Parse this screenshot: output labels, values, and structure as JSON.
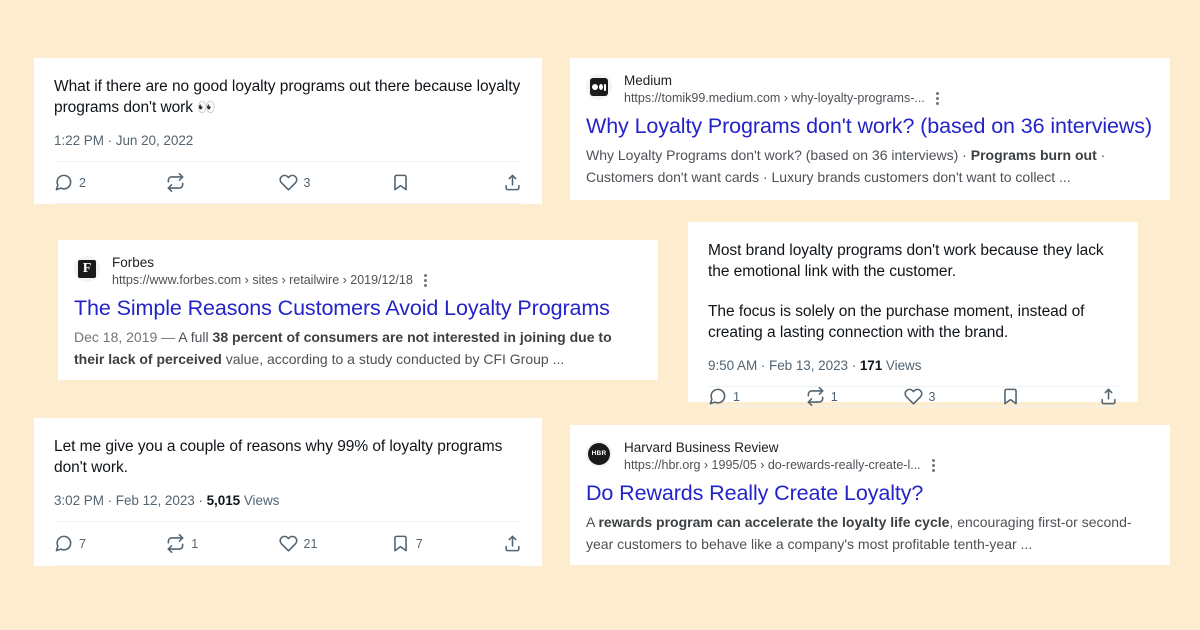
{
  "page": {
    "background_color": "#fdecce",
    "card_background": "#ffffff"
  },
  "colors": {
    "link_blue": "#1a0dab",
    "link_blue_alt": "#2323c8",
    "tweet_text": "#0f1419",
    "tweet_meta": "#536471",
    "snippet": "#4d5156"
  },
  "cards": {
    "tweet1": {
      "name": "tweet-card-no-good-loyalty-programs",
      "text_lines": [
        "What if there are no good loyalty programs out there because loyalty programs don't work"
      ],
      "emoji": "👀",
      "timestamp": "1:22 PM · Jun 20, 2022",
      "views": "",
      "views_label": "",
      "actions": {
        "reply": "2",
        "retweet": "",
        "like": "3",
        "bookmark": "",
        "share": ""
      }
    },
    "tweet2": {
      "name": "tweet-card-emotional-link",
      "text_lines": [
        "Most brand loyalty programs don't work because they lack the emotional link with the customer.",
        "The focus is solely on the purchase moment, instead of creating a lasting connection with the brand."
      ],
      "emoji": "",
      "timestamp": "9:50 AM · Feb 13, 2023 · ",
      "views": "171",
      "views_label": " Views",
      "actions": {
        "reply": "1",
        "retweet": "1",
        "like": "3",
        "bookmark": "",
        "share": ""
      }
    },
    "tweet3": {
      "name": "tweet-card-99-percent",
      "text_lines": [
        "Let me give you a couple of reasons why 99% of loyalty programs don't work."
      ],
      "emoji": "",
      "timestamp": "3:02 PM · Feb 12, 2023 · ",
      "views": "5,015",
      "views_label": " Views",
      "actions": {
        "reply": "7",
        "retweet": "1",
        "like": "21",
        "bookmark": "7",
        "share": ""
      }
    },
    "result_medium": {
      "name": "search-result-medium",
      "favicon_icon": "medium-favicon-icon",
      "site": "Medium",
      "url": "https://tomik99.medium.com › why-loyalty-programs-...",
      "title": "Why Loyalty Programs don't work? (based on 36 interviews)",
      "snippet_parts": [
        {
          "text": "Why Loyalty Programs don't work? (based on 36 interviews) · ",
          "bold": false
        },
        {
          "text": "Programs burn out",
          "bold": true
        },
        {
          "text": " · Customers don't want cards · Luxury brands customers don't want to collect ...",
          "bold": false
        }
      ]
    },
    "result_forbes": {
      "name": "search-result-forbes",
      "favicon_icon": "forbes-favicon-icon",
      "site": "Forbes",
      "url": "https://www.forbes.com › sites › retailwire › 2019/12/18",
      "title": "The Simple Reasons Customers Avoid Loyalty Programs",
      "snippet_parts": [
        {
          "text": "Dec 18, 2019 — ",
          "bold": false,
          "date": true
        },
        {
          "text": "A full ",
          "bold": false
        },
        {
          "text": "38 percent of consumers are not interested in joining due to their lack of perceived",
          "bold": true
        },
        {
          "text": " value, according to a study conducted by CFI Group ...",
          "bold": false
        }
      ]
    },
    "result_hbr": {
      "name": "search-result-hbr",
      "favicon_icon": "hbr-favicon-icon",
      "favicon_text": "HBR",
      "site": "Harvard Business Review",
      "url": "https://hbr.org › 1995/05 › do-rewards-really-create-l...",
      "title": "Do Rewards Really Create Loyalty?",
      "snippet_parts": [
        {
          "text": "A ",
          "bold": false
        },
        {
          "text": "rewards program can accelerate the loyalty life cycle",
          "bold": true
        },
        {
          "text": ", encouraging first-or second-year customers to behave like a company's most profitable tenth-year ...",
          "bold": false
        }
      ]
    }
  },
  "icons": {
    "reply": "reply-icon",
    "retweet": "retweet-icon",
    "like": "like-heart-icon",
    "bookmark": "bookmark-icon",
    "share": "share-icon",
    "overflow": "more-options-icon"
  }
}
